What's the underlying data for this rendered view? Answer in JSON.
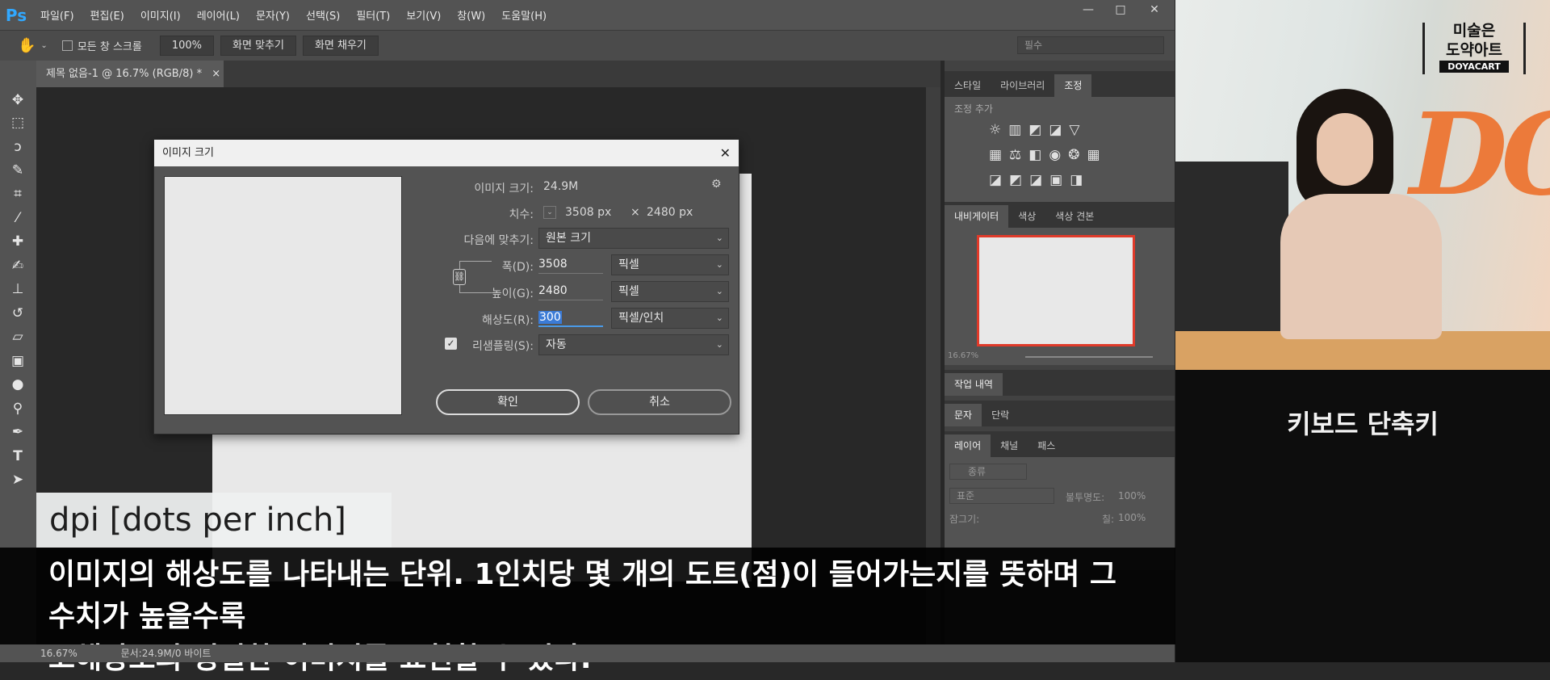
{
  "app": {
    "logo": "Ps"
  },
  "menu": [
    "파일(F)",
    "편집(E)",
    "이미지(I)",
    "레이어(L)",
    "문자(Y)",
    "선택(S)",
    "필터(T)",
    "보기(V)",
    "창(W)",
    "도움말(H)"
  ],
  "window_controls": {
    "minimize": "—",
    "restore": "□",
    "close": "✕"
  },
  "options": {
    "scroll_all": "모든 창 스크롤",
    "zoom": "100%",
    "fit_screen": "화면 맞추기",
    "fill_screen": "화면 채우기",
    "workspace": "필수"
  },
  "document_tab": {
    "title": "제목 없음-1 @ 16.7% (RGB/8) *",
    "close": "×"
  },
  "panels": {
    "top_tabs": [
      "스타일",
      "라이브러리",
      "조정"
    ],
    "adjust_title": "조정 추가",
    "nav_tabs": [
      "내비게이터",
      "색상",
      "색상 견본"
    ],
    "nav_zoom": "16.67%",
    "history_tab": "작업 내역",
    "text_tabs": [
      "문자",
      "단락"
    ],
    "layer_tabs": [
      "레이어",
      "채널",
      "패스"
    ],
    "layer_filter": "종류",
    "blend_mode": "표준",
    "opacity_label": "불투명도:",
    "opacity_value": "100%",
    "lock_label": "잠그기:",
    "fill_label": "칠:",
    "fill_value": "100%"
  },
  "dialog": {
    "title": "이미지 크기",
    "close": "✕",
    "image_size_label": "이미지 크기:",
    "image_size_value": "24.9M",
    "dimensions_label": "치수:",
    "dimensions_w": "3508 px",
    "dimensions_x": "×",
    "dimensions_h": "2480 px",
    "fit_to_label": "다음에 맞추기:",
    "fit_to_value": "원본 크기",
    "width_label": "폭(D):",
    "width_value": "3508",
    "width_unit": "픽셀",
    "height_label": "높이(G):",
    "height_value": "2480",
    "height_unit": "픽셀",
    "resolution_label": "해상도(R):",
    "resolution_value": "300",
    "resolution_unit": "픽셀/인치",
    "resample_label": "리샘플링(S):",
    "resample_checked": true,
    "resample_value": "자동",
    "ok": "확인",
    "cancel": "취소"
  },
  "video": {
    "logo_line1": "미술은",
    "logo_line2": "도약아트",
    "logo_brand": "DOYACART",
    "bg_text": "DO",
    "side_caption": "키보드 단축키"
  },
  "subtitles": {
    "term": "dpi [dots per inch]",
    "line1": "이미지의 해상도를 나타내는 단위. 1인치당 몇 개의 도트(점)이 들어가는지를 뜻하며 그 수치가 높을수록",
    "line2": "고해상도의 정밀한 이미지를 표현할 수 있다."
  },
  "status": {
    "zoom": "16.67%",
    "doc": "문서:24.9M/0 바이트"
  }
}
